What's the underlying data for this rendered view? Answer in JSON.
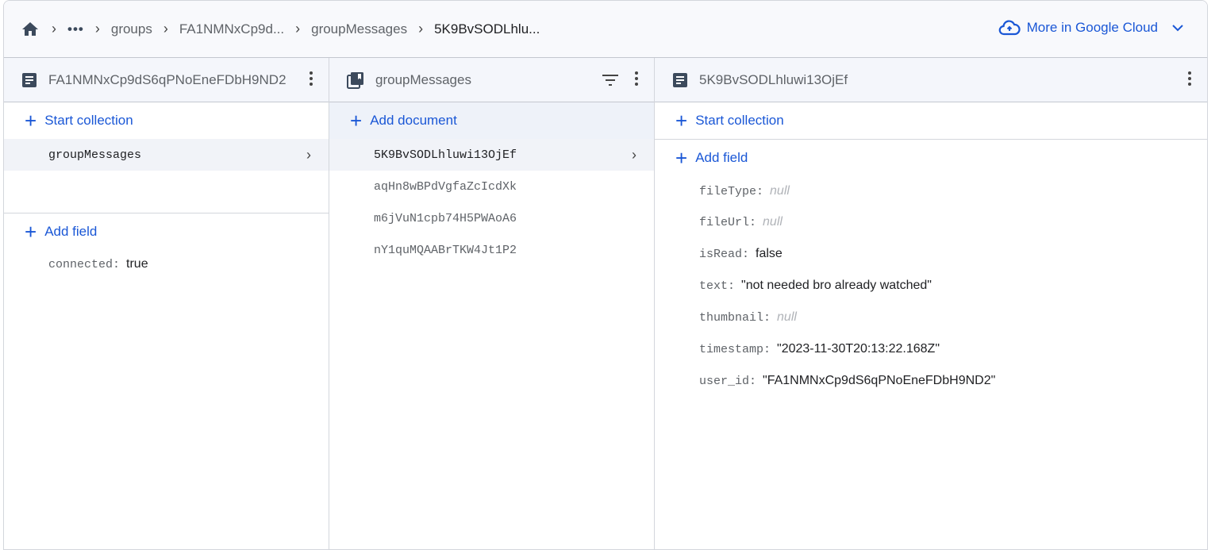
{
  "breadcrumb": {
    "items": [
      "groups",
      "FA1NMNxCp9d...",
      "groupMessages"
    ],
    "current": "5K9BvSODLhlu...",
    "more_label": "More in Google Cloud"
  },
  "panel1": {
    "title": "FA1NMNxCp9dS6qPNoEneFDbH9ND2",
    "start_collection": "Start collection",
    "collections": [
      "groupMessages"
    ],
    "add_field": "Add field",
    "fields": [
      {
        "key": "connected:",
        "value": "true"
      }
    ]
  },
  "panel2": {
    "title": "groupMessages",
    "add_document": "Add document",
    "documents": [
      "5K9BvSODLhluwi13OjEf",
      "aqHn8wBPdVgfaZcIcdXk",
      "m6jVuN1cpb74H5PWAoA6",
      "nY1quMQAABrTKW4Jt1P2"
    ]
  },
  "panel3": {
    "title": "5K9BvSODLhluwi13OjEf",
    "start_collection": "Start collection",
    "add_field": "Add field",
    "fields": [
      {
        "key": "fileType:",
        "value": "null"
      },
      {
        "key": "fileUrl:",
        "value": "null"
      },
      {
        "key": "isRead:",
        "value": "false"
      },
      {
        "key": "text:",
        "value": "\"not needed bro already watched\""
      },
      {
        "key": "thumbnail:",
        "value": "null"
      },
      {
        "key": "timestamp:",
        "value": "\"2023-11-30T20:13:22.168Z\""
      },
      {
        "key": "user_id:",
        "value": "\"FA1NMNxCp9dS6qPNoEneFDbH9ND2\""
      }
    ]
  }
}
